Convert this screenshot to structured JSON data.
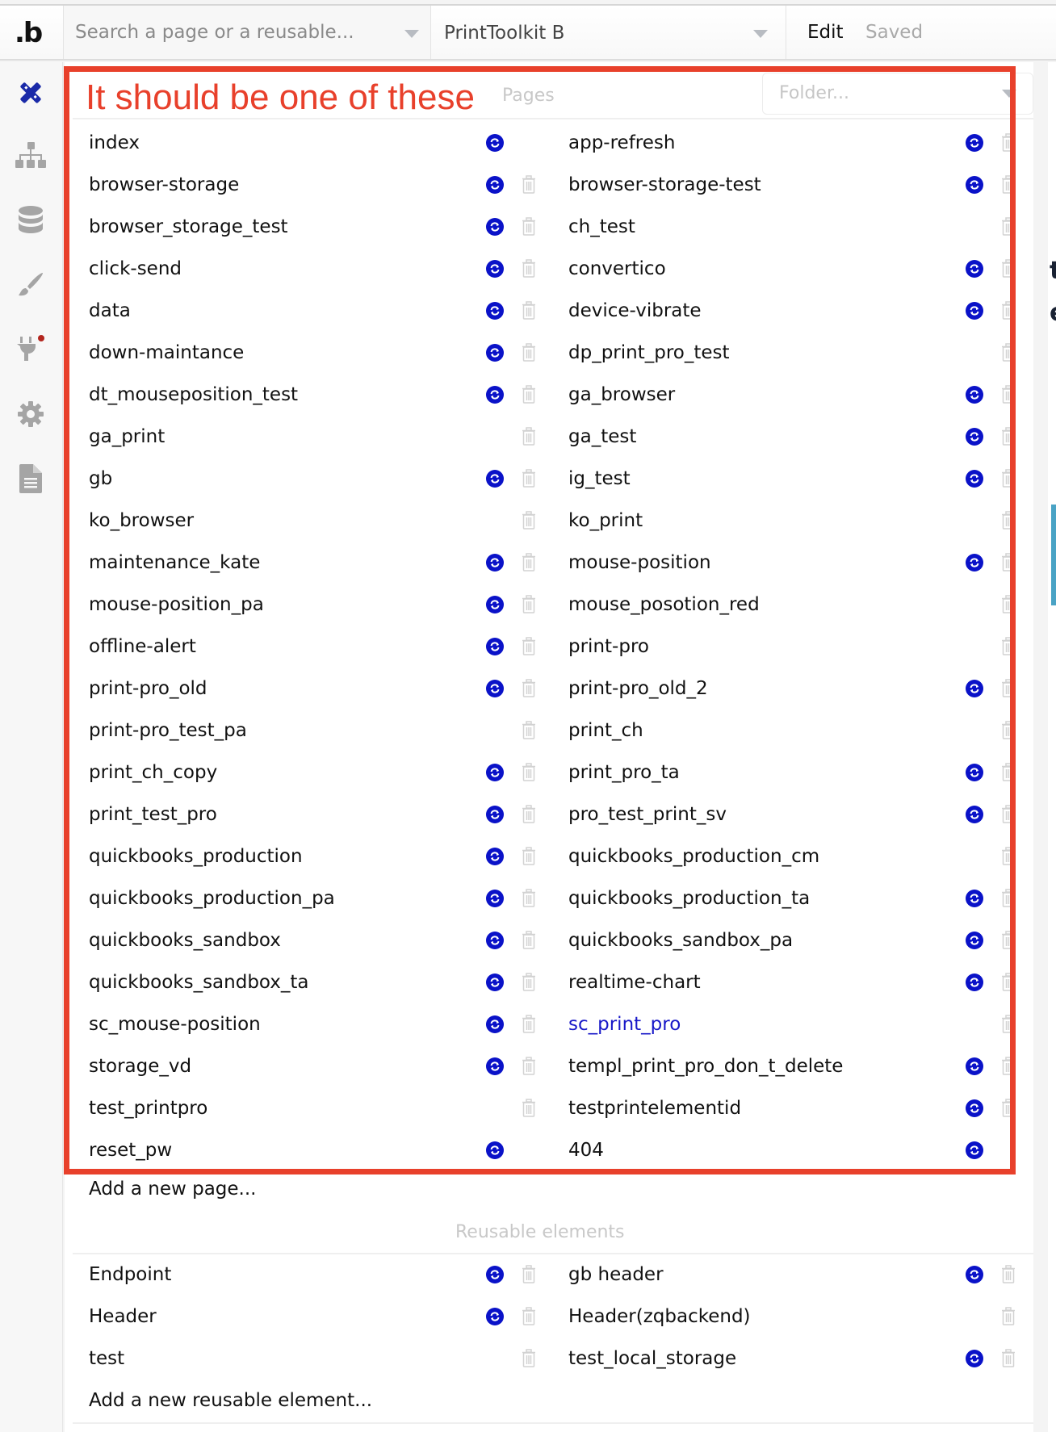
{
  "topbar": {
    "logo": ".b",
    "search_placeholder": "Search a page or a reusable...",
    "search_value": "",
    "app_name": "PrintToolkit B",
    "mode": "Edit",
    "status": "Saved"
  },
  "sidebar": {
    "items": [
      {
        "name": "design",
        "icon": "design-icon",
        "active": true
      },
      {
        "name": "workflow",
        "icon": "sitemap-icon",
        "active": false
      },
      {
        "name": "data",
        "icon": "database-icon",
        "active": false
      },
      {
        "name": "styles",
        "icon": "brush-icon",
        "active": false
      },
      {
        "name": "plugins",
        "icon": "plug-icon",
        "active": false,
        "badge": true
      },
      {
        "name": "settings",
        "icon": "gear-icon",
        "active": false
      },
      {
        "name": "logs",
        "icon": "document-icon",
        "active": false
      }
    ]
  },
  "annotation": {
    "text": "It should be one of these",
    "color": "#e8402b"
  },
  "pages": {
    "title": "Pages",
    "folder_placeholder": "Folder...",
    "left": [
      {
        "name": "index",
        "sync": true,
        "trash": false
      },
      {
        "name": "browser-storage",
        "sync": true,
        "trash": true
      },
      {
        "name": "browser_storage_test",
        "sync": true,
        "trash": true
      },
      {
        "name": "click-send",
        "sync": true,
        "trash": true
      },
      {
        "name": "data",
        "sync": true,
        "trash": true
      },
      {
        "name": "down-maintance",
        "sync": true,
        "trash": true
      },
      {
        "name": "dt_mouseposition_test",
        "sync": true,
        "trash": true
      },
      {
        "name": "ga_print",
        "sync": false,
        "trash": true
      },
      {
        "name": "gb",
        "sync": true,
        "trash": true
      },
      {
        "name": "ko_browser",
        "sync": false,
        "trash": true
      },
      {
        "name": "maintenance_kate",
        "sync": true,
        "trash": true
      },
      {
        "name": "mouse-position_pa",
        "sync": true,
        "trash": true
      },
      {
        "name": "offline-alert",
        "sync": true,
        "trash": true
      },
      {
        "name": "print-pro_old",
        "sync": true,
        "trash": true
      },
      {
        "name": "print-pro_test_pa",
        "sync": false,
        "trash": true
      },
      {
        "name": "print_ch_copy",
        "sync": true,
        "trash": true
      },
      {
        "name": "print_test_pro",
        "sync": true,
        "trash": true
      },
      {
        "name": "quickbooks_production",
        "sync": true,
        "trash": true
      },
      {
        "name": "quickbooks_production_pa",
        "sync": true,
        "trash": true
      },
      {
        "name": "quickbooks_sandbox",
        "sync": true,
        "trash": true
      },
      {
        "name": "quickbooks_sandbox_ta",
        "sync": true,
        "trash": true
      },
      {
        "name": "sc_mouse-position",
        "sync": true,
        "trash": true
      },
      {
        "name": "storage_vd",
        "sync": true,
        "trash": true
      },
      {
        "name": "test_printpro",
        "sync": false,
        "trash": true
      },
      {
        "name": "reset_pw",
        "sync": true,
        "trash": false
      }
    ],
    "right": [
      {
        "name": "app-refresh",
        "sync": true,
        "trash": true
      },
      {
        "name": "browser-storage-test",
        "sync": true,
        "trash": true
      },
      {
        "name": "ch_test",
        "sync": false,
        "trash": true
      },
      {
        "name": "convertico",
        "sync": true,
        "trash": true
      },
      {
        "name": "device-vibrate",
        "sync": true,
        "trash": true
      },
      {
        "name": "dp_print_pro_test",
        "sync": false,
        "trash": true
      },
      {
        "name": "ga_browser",
        "sync": true,
        "trash": true
      },
      {
        "name": "ga_test",
        "sync": true,
        "trash": true
      },
      {
        "name": "ig_test",
        "sync": true,
        "trash": true
      },
      {
        "name": "ko_print",
        "sync": false,
        "trash": true
      },
      {
        "name": "mouse-position",
        "sync": true,
        "trash": true
      },
      {
        "name": "mouse_posotion_red",
        "sync": false,
        "trash": true
      },
      {
        "name": "print-pro",
        "sync": false,
        "trash": true
      },
      {
        "name": "print-pro_old_2",
        "sync": true,
        "trash": true
      },
      {
        "name": "print_ch",
        "sync": false,
        "trash": true
      },
      {
        "name": "print_pro_ta",
        "sync": true,
        "trash": true
      },
      {
        "name": "pro_test_print_sv",
        "sync": true,
        "trash": true
      },
      {
        "name": "quickbooks_production_cm",
        "sync": false,
        "trash": true
      },
      {
        "name": "quickbooks_production_ta",
        "sync": true,
        "trash": true
      },
      {
        "name": "quickbooks_sandbox_pa",
        "sync": true,
        "trash": true
      },
      {
        "name": "realtime-chart",
        "sync": true,
        "trash": true
      },
      {
        "name": "sc_print_pro",
        "sync": false,
        "trash": true,
        "active": true
      },
      {
        "name": "templ_print_pro_don_t_delete",
        "sync": true,
        "trash": true
      },
      {
        "name": "testprintelementid",
        "sync": true,
        "trash": true
      },
      {
        "name": "404",
        "sync": true,
        "trash": false
      }
    ],
    "add_label": "Add a new page..."
  },
  "reusables": {
    "title": "Reusable elements",
    "left": [
      {
        "name": "Endpoint",
        "sync": true,
        "trash": true
      },
      {
        "name": "Header",
        "sync": true,
        "trash": true
      },
      {
        "name": "test",
        "sync": false,
        "trash": true
      }
    ],
    "right": [
      {
        "name": "gb header",
        "sync": true,
        "trash": true
      },
      {
        "name": "Header(zqbackend)",
        "sync": false,
        "trash": true
      },
      {
        "name": "test_local_storage",
        "sync": true,
        "trash": true
      }
    ],
    "add_label": "Add a new reusable element..."
  },
  "background": {
    "fragment_1": "t",
    "fragment_2": "e"
  },
  "colors": {
    "accent": "#0a12c8",
    "active_sidebar": "#1a2aa8",
    "annotation": "#e8402b",
    "badge": "#b3261e"
  }
}
